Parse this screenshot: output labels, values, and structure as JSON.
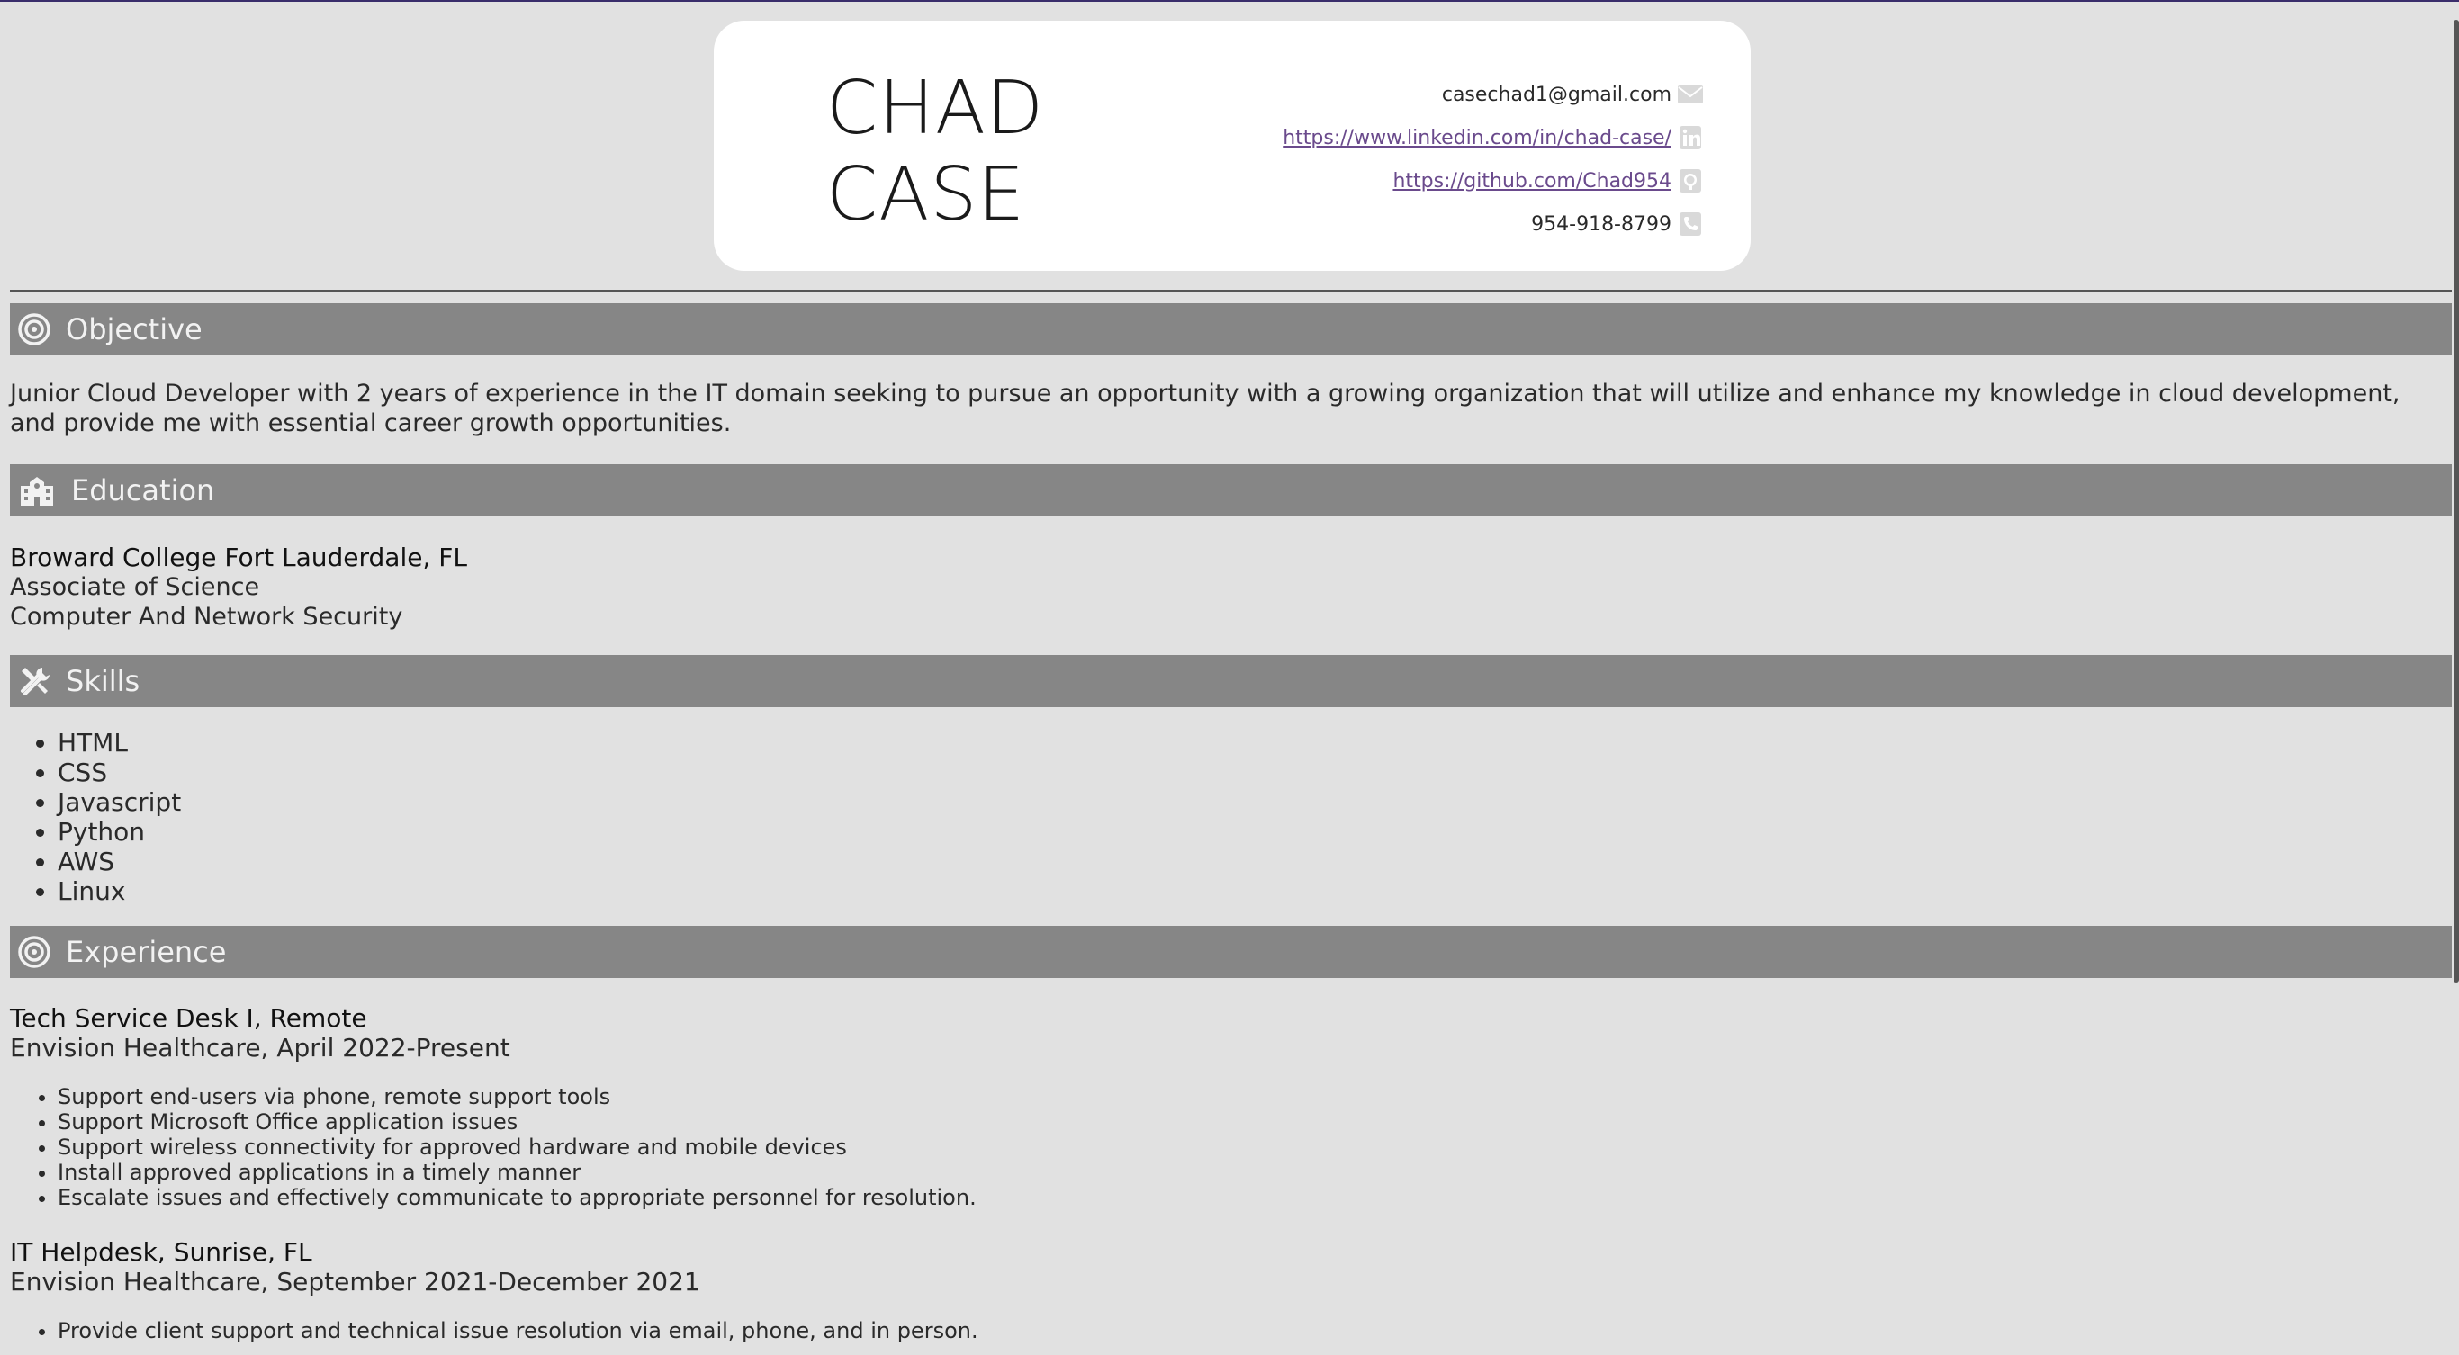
{
  "header": {
    "first_name": "CHAD",
    "last_name": "CASE",
    "contacts": {
      "email": "casechad1@gmail.com",
      "linkedin": "https://www.linkedin.com/in/chad-case/",
      "github": "https://github.com/Chad954",
      "phone": "954-918-8799"
    },
    "icons": [
      "envelope-icon",
      "linkedin-icon",
      "github-icon",
      "phone-icon"
    ]
  },
  "objective": {
    "heading": "Objective",
    "icon": "target-icon",
    "text": "Junior Cloud Developer with 2 years of experience in the IT domain seeking to pursue an opportunity with a growing organization that will utilize and enhance my knowledge in cloud development, and provide me with essential career growth opportunities."
  },
  "education": {
    "heading": "Education",
    "icon": "school-icon",
    "school": "Broward College Fort Lauderdale, FL",
    "degree": "Associate of Science",
    "major": "Computer And Network Security"
  },
  "skills": {
    "heading": "Skills",
    "icon": "tools-icon",
    "items": [
      "HTML",
      "CSS",
      "Javascript",
      "Python",
      "AWS",
      "Linux"
    ]
  },
  "experience": {
    "heading": "Experience",
    "icon": "target-icon",
    "jobs": [
      {
        "title": "Tech Service Desk I, Remote",
        "company": "Envision Healthcare, April 2022-Present",
        "duties": [
          "Support end-users via phone, remote support tools",
          "Support Microsoft Office application issues",
          "Support wireless connectivity for approved hardware and mobile devices",
          "Install approved applications in a timely manner",
          "Escalate issues and effectively communicate to appropriate personnel for resolution."
        ]
      },
      {
        "title": "IT Helpdesk, Sunrise, FL",
        "company": "Envision Healthcare, September 2021-December 2021",
        "duties": [
          "Provide client support and technical issue resolution via email, phone, and in person."
        ]
      }
    ]
  },
  "colors": {
    "background": "#e1e1e1",
    "section_bar": "#868686",
    "link": "#6a4a8c",
    "card": "#ffffff"
  }
}
